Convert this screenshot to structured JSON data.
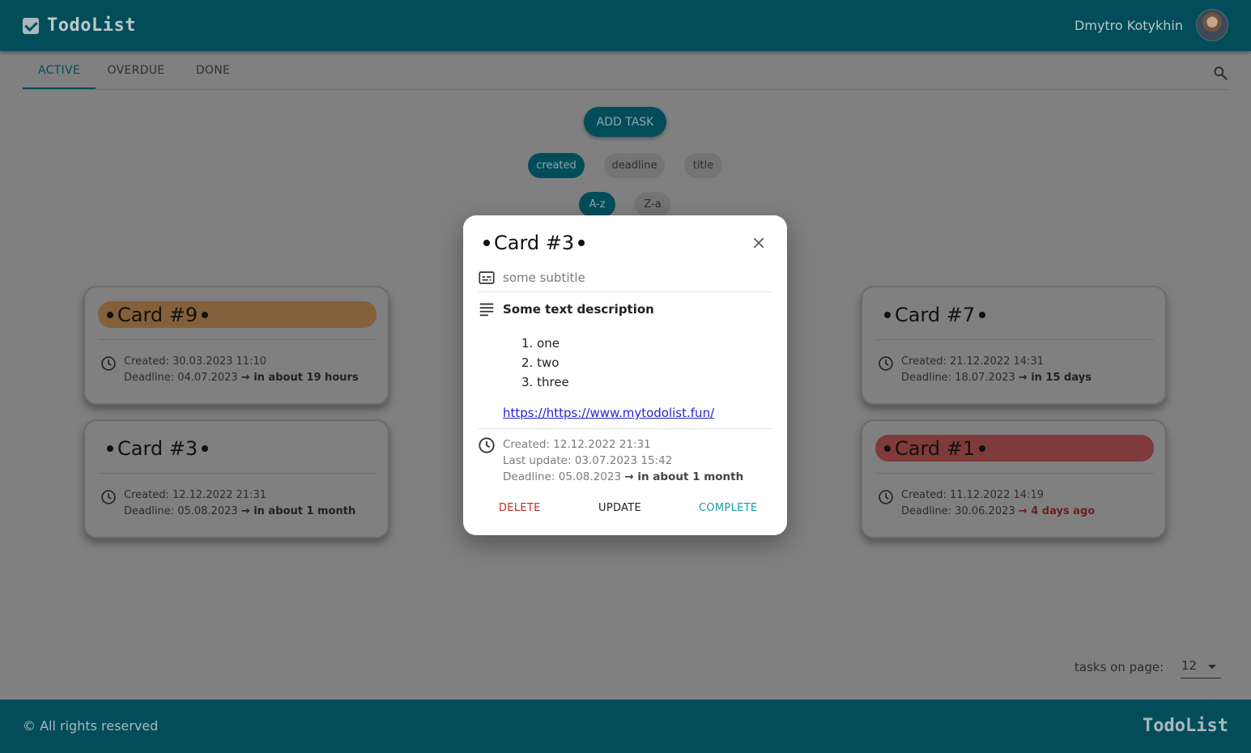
{
  "header": {
    "brand": "TodoList",
    "user_name": "Dmytro Kotykhin"
  },
  "tabs": [
    {
      "label": "ACTIVE",
      "active": true
    },
    {
      "label": "OVERDUE",
      "active": false
    },
    {
      "label": "DONE",
      "active": false
    }
  ],
  "controls": {
    "add_task_label": "ADD TASK",
    "sort_fields": [
      {
        "label": "created",
        "selected": true
      },
      {
        "label": "deadline",
        "selected": false
      },
      {
        "label": "title",
        "selected": false
      }
    ],
    "sort_orders": [
      {
        "label": "A-z",
        "selected": true
      },
      {
        "label": "Z-a",
        "selected": false
      }
    ]
  },
  "cards": [
    {
      "title": "Card #9",
      "highlight": "orange",
      "created": "Created: 30.03.2023 11:10",
      "deadline": "Deadline: 04.07.2023",
      "relative": "→ in about 19 hours",
      "overdue": false
    },
    {
      "title": "Card #3",
      "highlight": "none",
      "created": "Created: 12.12.2022 21:31",
      "deadline": "Deadline: 05.08.2023",
      "relative": "→ in about 1 month",
      "overdue": false
    },
    {
      "title": "Card #7",
      "highlight": "none",
      "created": "Created: 21.12.2022 14:31",
      "deadline": "Deadline: 18.07.2023",
      "relative": "→ in 15 days",
      "overdue": false
    },
    {
      "title": "Card #1",
      "highlight": "red",
      "created": "Created: 11.12.2022 14:19",
      "deadline": "Deadline: 30.06.2023",
      "relative": "→ 4 days ago",
      "overdue": true
    }
  ],
  "modal": {
    "title": "Card #3",
    "subtitle": "some subtitle",
    "description": "Some text description",
    "list": [
      {
        "num": "1.",
        "text": "one"
      },
      {
        "num": "2.",
        "text": "two"
      },
      {
        "num": "3.",
        "text": "three"
      }
    ],
    "link": "https://https://www.mytodolist.fun/",
    "created": "Created: 12.12.2022 21:31",
    "last_update": "Last update: 03.07.2023 15:42",
    "deadline": "Deadline: 05.08.2023",
    "deadline_relative": "→ in about 1 month",
    "delete_label": "DELETE",
    "update_label": "UPDATE",
    "complete_label": "COMPLETE"
  },
  "pagination": {
    "label": "tasks on page:",
    "value": "12"
  },
  "footer": {
    "copyright": "© All rights reserved",
    "brand": "TodoList"
  },
  "colors": {
    "primary": "#034d5a",
    "overlay": "#808080",
    "delete": "#c62828",
    "complete": "#12a0a0",
    "link": "#2626c9"
  },
  "icons": {
    "brand": "check-square-icon",
    "search": "search-icon",
    "clock": "clock-icon",
    "subtitle": "subtitles-icon",
    "description": "notes-icon",
    "close": "close-icon",
    "dropdown": "caret-down-icon"
  }
}
